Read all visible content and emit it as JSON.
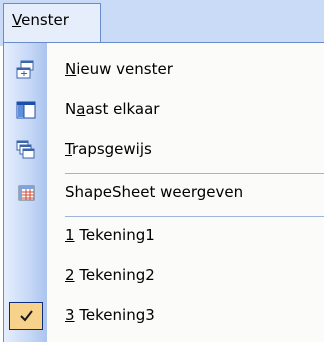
{
  "menu": {
    "title": {
      "pre": "",
      "mnemonic": "V",
      "post": "enster"
    },
    "items": [
      {
        "pre": "",
        "mnemonic": "N",
        "post": "ieuw venster",
        "icon": "new-window-icon"
      },
      {
        "pre": "N",
        "mnemonic": "a",
        "post": "ast elkaar",
        "icon": "tile-icon"
      },
      {
        "pre": "",
        "mnemonic": "T",
        "post": "rapsgewijs",
        "icon": "cascade-icon"
      },
      {
        "pre": "ShapeSheet weergeven",
        "mnemonic": "",
        "post": "",
        "icon": "shapesheet-icon"
      },
      {
        "pre": "",
        "mnemonic": "1",
        "post": " Tekening1",
        "icon": ""
      },
      {
        "pre": "",
        "mnemonic": "2",
        "post": " Tekening2",
        "icon": ""
      },
      {
        "pre": "",
        "mnemonic": "3",
        "post": " Tekening3",
        "icon": "checkmark-icon",
        "checked": true
      }
    ]
  },
  "colors": {
    "menubar": "#c9dbf6",
    "border": "#6a8ccb",
    "highlight": "#f7d28b"
  }
}
